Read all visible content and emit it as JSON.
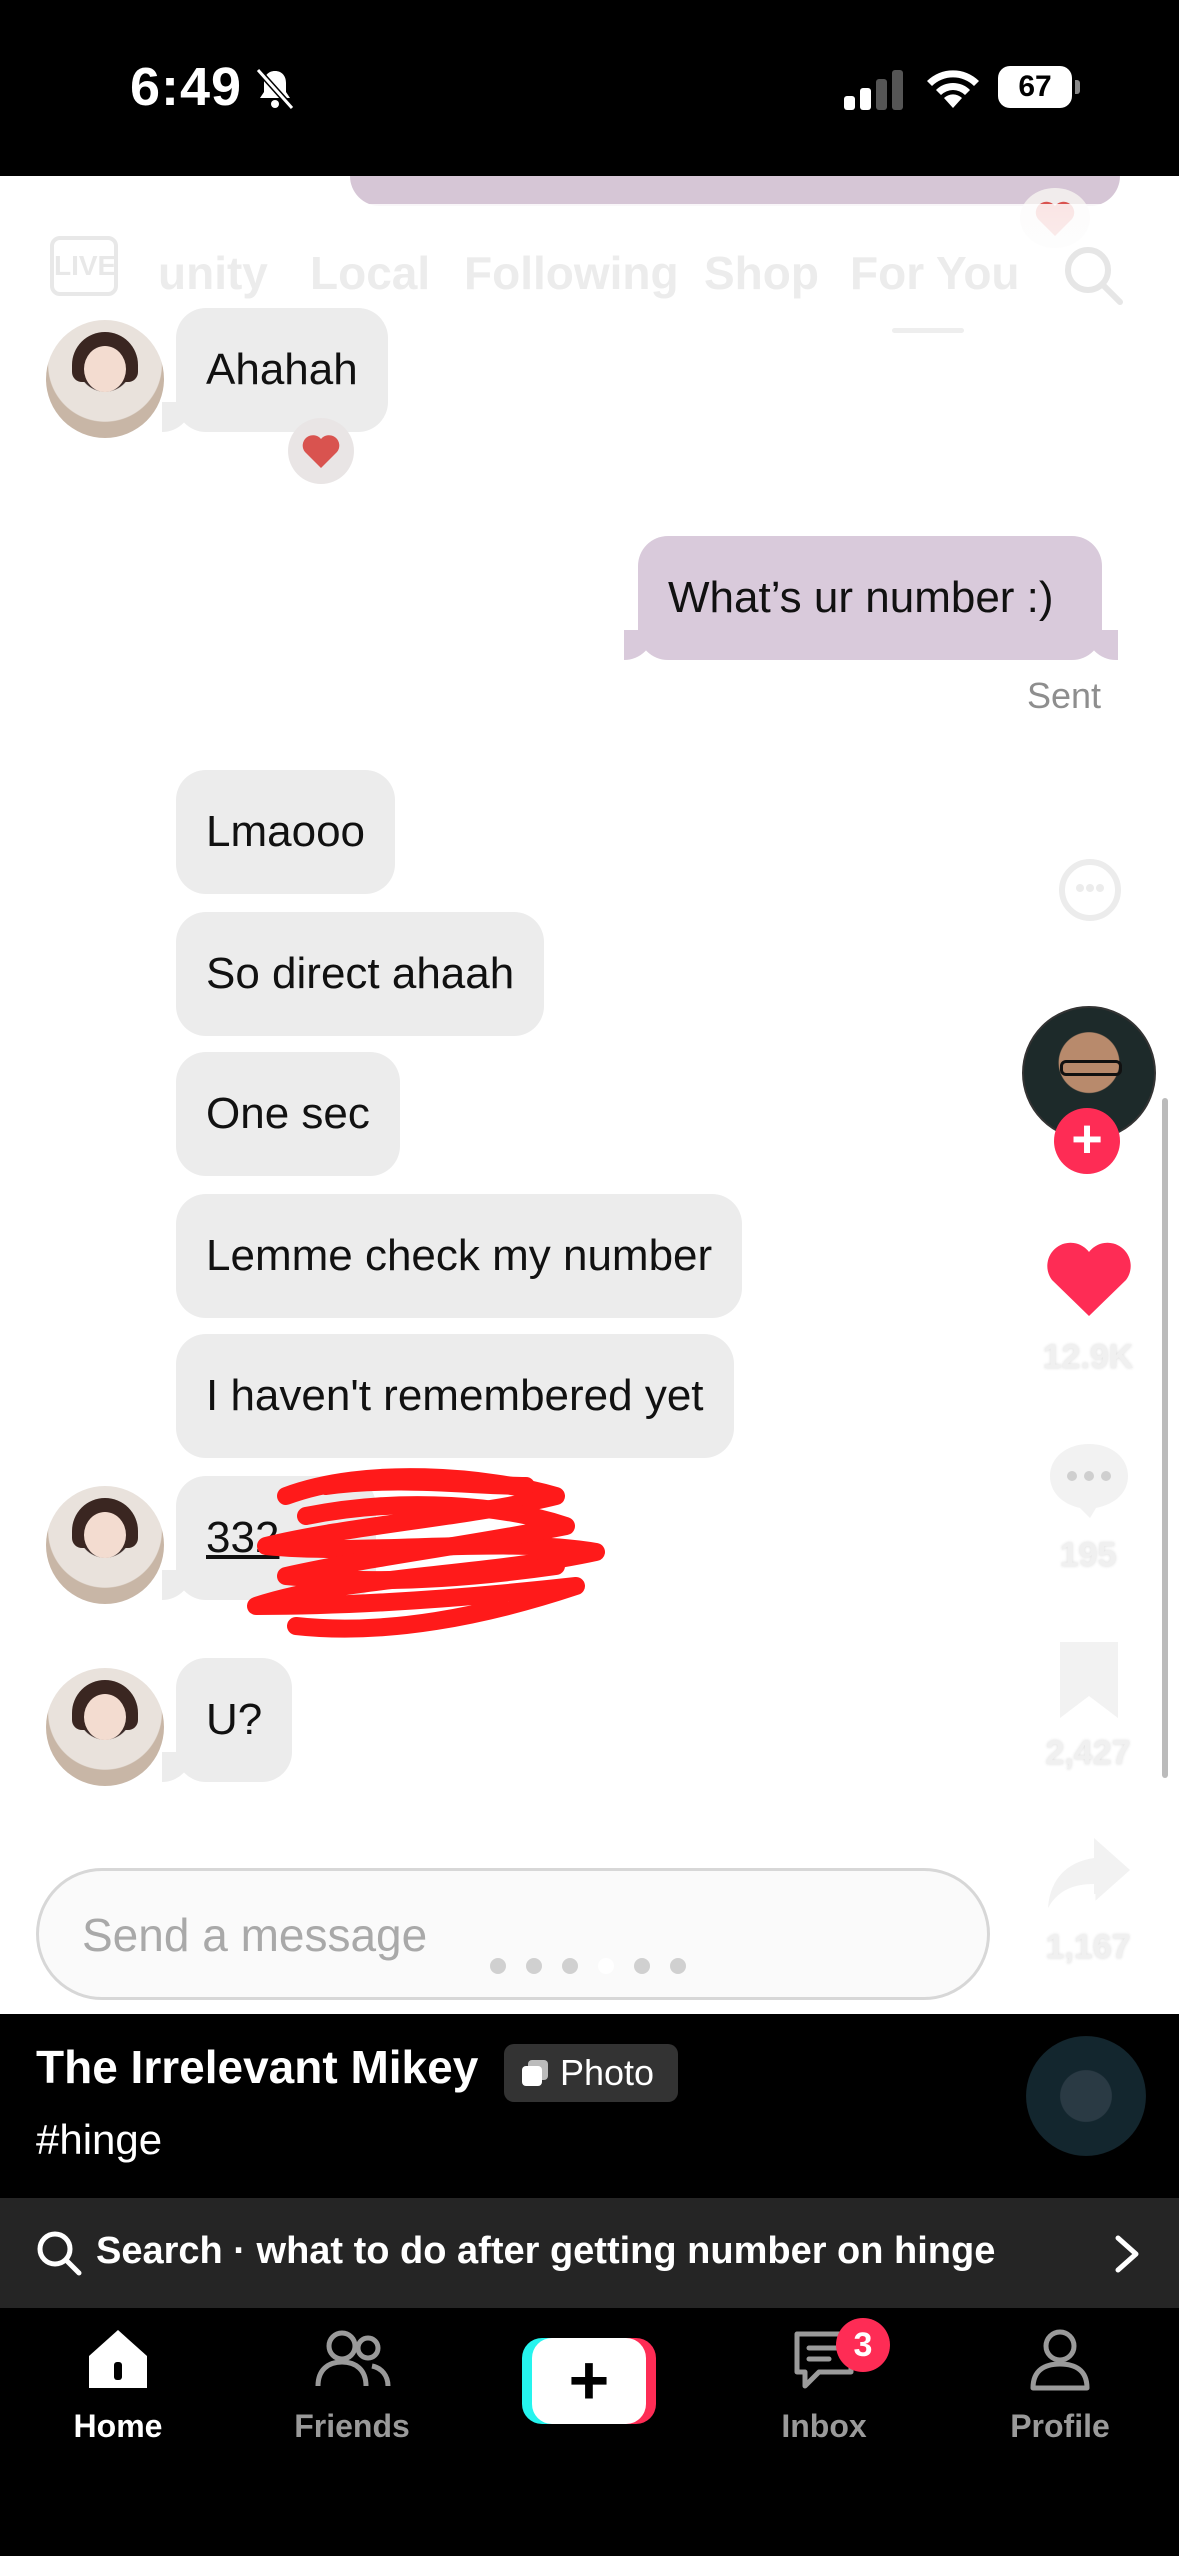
{
  "status_bar": {
    "time": "6:49",
    "battery": "67"
  },
  "feed_tabs": {
    "live": "LIVE",
    "items": [
      "unity",
      "Local",
      "Following",
      "Shop",
      "For You"
    ]
  },
  "chat": {
    "messages": [
      {
        "from": "them",
        "text": "Ahahah",
        "reaction": "heart"
      },
      {
        "from": "me",
        "text": "What’s ur number :)",
        "status": "Sent"
      },
      {
        "from": "them",
        "text": "Lmaooo"
      },
      {
        "from": "them",
        "text": "So direct ahaah"
      },
      {
        "from": "them",
        "text": "One sec"
      },
      {
        "from": "them",
        "text": "Lemme check my number"
      },
      {
        "from": "them",
        "text": "I haven't remembered yet"
      },
      {
        "from": "them",
        "text": "332"
      },
      {
        "from": "them",
        "text": "U?"
      }
    ],
    "input_placeholder": "Send a message"
  },
  "actions": {
    "likes": "12.9K",
    "comments": "195",
    "saves": "2,427",
    "shares": "1,167",
    "like_color": "#fe2c55"
  },
  "caption": {
    "creator": "The Irrelevant Mikey",
    "badge": "Photo",
    "hashtag": "#hinge"
  },
  "search": {
    "text": "Search · what to do after getting number on hinge"
  },
  "bottom_nav": {
    "home": "Home",
    "friends": "Friends",
    "inbox": "Inbox",
    "inbox_badge": "3",
    "profile": "Profile",
    "create": "+"
  },
  "carousel": {
    "total": 6,
    "active_index": 3
  }
}
